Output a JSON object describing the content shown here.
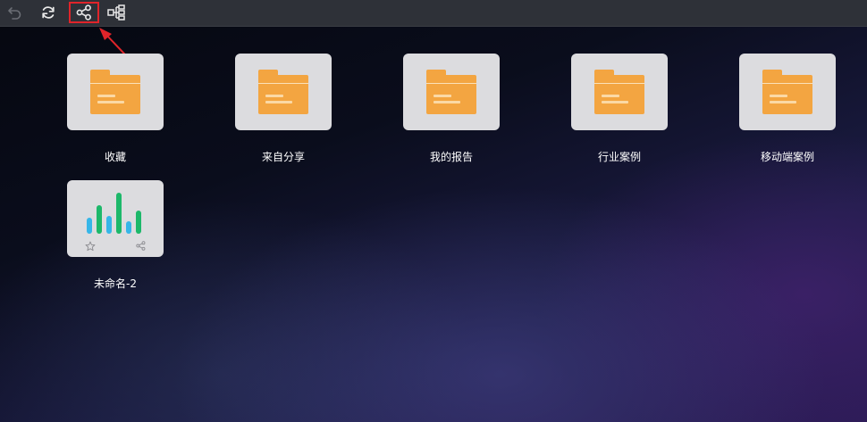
{
  "toolbar": {
    "icons": [
      "undo-icon",
      "refresh-icon",
      "share-icon",
      "structure-icon"
    ],
    "highlight_color": "#e0242a"
  },
  "folders": [
    {
      "label": "收藏"
    },
    {
      "label": "来自分享"
    },
    {
      "label": "我的报告"
    },
    {
      "label": "行业案例"
    },
    {
      "label": "移动端案例"
    }
  ],
  "reports": [
    {
      "label": "未命名-2"
    }
  ],
  "colors": {
    "folder": "#f3a541",
    "card": "#dcdcdf",
    "bar_blue": "#36b6e8",
    "bar_green": "#1db86a",
    "arrow": "#e0242a"
  }
}
